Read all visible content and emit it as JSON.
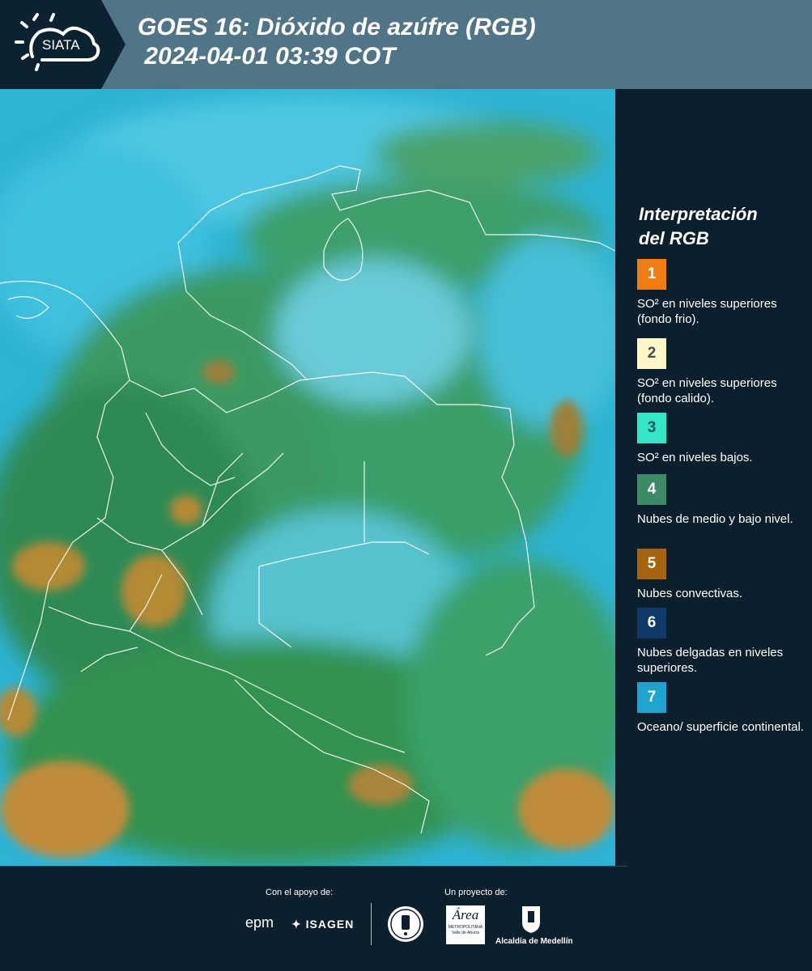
{
  "header": {
    "logo_text": "SIATA",
    "title_line1": "GOES 16: Dióxido de azúfre (RGB)",
    "title_line2": " 2024-04-01 03:39 COT"
  },
  "legend": {
    "title_line1": "Interpretación",
    "title_line2": "del RGB",
    "items": [
      {
        "number": "1",
        "color": "#f07c14",
        "num_color": "#ffffff",
        "label": "SO² en niveles superiores (fondo frio)."
      },
      {
        "number": "2",
        "color": "#fff7c7",
        "num_color": "#4a4a4a",
        "label": "SO² en niveles superiores (fondo calido)."
      },
      {
        "number": "3",
        "color": "#33e6c6",
        "num_color": "#1d5a56",
        "label": "SO² en niveles bajos."
      },
      {
        "number": "4",
        "color": "#3c8a66",
        "num_color": "#ffffff",
        "label": "Nubes de medio y bajo nivel."
      },
      {
        "number": "5",
        "color": "#a66410",
        "num_color": "#ffffff",
        "label": "Nubes convectivas."
      },
      {
        "number": "6",
        "color": "#0e3a6a",
        "num_color": "#ffffff",
        "label": "Nubes delgadas en niveles superiores."
      },
      {
        "number": "7",
        "color": "#1ea4cf",
        "num_color": "#ffffff",
        "label": "Oceano/ superficie continental."
      }
    ]
  },
  "footer": {
    "support_label": "Con el apoyo de:",
    "project_label": "Un proyecto de:",
    "sponsor1": "epm",
    "sponsor2": "ISAGEN",
    "sponsor3_line1": "Área",
    "sponsor3_line2": "METROPOLITANA",
    "sponsor3_line3": "Valle de Aburrá",
    "sponsor4": "Alcaldía de Medellín"
  }
}
